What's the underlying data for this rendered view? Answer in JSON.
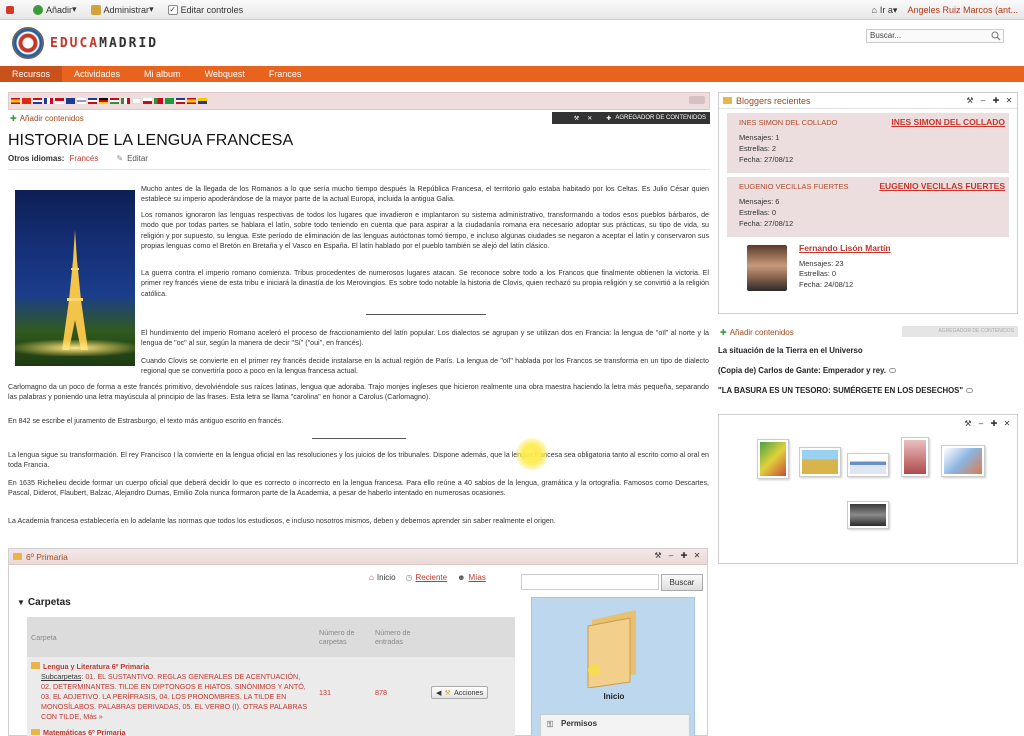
{
  "dockbar": {
    "add": "Añadir",
    "admin": "Administrar",
    "edit_controls": "Editar controles",
    "goto": "Ir a",
    "user": "Angeles Ruiz Marcos (ant..."
  },
  "header": {
    "logo_part1": "EDUCA",
    "logo_part2": "MADRID",
    "search_value": "Buscar..."
  },
  "nav": {
    "tabs": [
      {
        "label": "Recursos",
        "active": true
      },
      {
        "label": "Actividades",
        "active": false
      },
      {
        "label": "Mi album",
        "active": false
      },
      {
        "label": "Webquest",
        "active": false
      },
      {
        "label": "Frances",
        "active": false
      }
    ]
  },
  "main": {
    "add_content": "Añadir contenidos",
    "aggregator": "AGREGADOR DE CONTENIDOS",
    "title": "HISTORIA DE LA LENGUA FRANCESA",
    "other_lang_label": "Otros idiomas:",
    "other_lang_value": "Francés",
    "edit": "Editar",
    "paragraphs": [
      "Mucho antes de la llegada de los Romanos a lo que sería mucho tiempo después la República Francesa, el territorio galo estaba habitado por los Celtas. Es Julio César quien establece su imperio apoderándose de la mayor parte de la actual Europa, incluida la antigua Galia.",
      "Los romanos ignoraron las lenguas respectivas de todos los lugares que invadieron e implantaron su sistema administrativo, transformando a todos esos pueblos bárbaros, de modo que por todas partes se hablara el latín, sobre todo teniendo en cuenta que para aspirar a la ciudadanía romana era necesario adoptar sus prácticas, su tipo de vida, su religión y por supuesto, su lengua. Este período de eliminación de las lenguas autóctonas tomó tiempo, e incluso algunas ciudades se negaron a aceptar el latín y conservaron sus propias lenguas como el Bretón en Bretaña y el Vasco en España. El latín hablado por el pueblo también se alejó del latín clásico.",
      "La guerra contra el imperio romano comienza. Tribus procedentes de numerosos lugares atacan. Se reconoce sobre todo a los Francos que finalmente obtienen la victoria. El primer rey francés viene de esta tribu e iniciará la dinastía de los Merovingios. Es sobre todo notable la historia de Clovis, quien rechazó su propia religión y se convirtió a la religión católica.",
      "El hundimiento del imperio Romano aceleró el proceso de fraccionamiento del latín popular. Los dialectos se agrupan y se utilizan dos en Francia: la lengua de \"oïl\" al norte y la lengua de \"oc\" al sur, según la manera de decir \"Sí\" (\"oui\", en francés).",
      "Cuando Clovis se convierte en el primer rey francés decide instalarse en la actual región de París. La lengua de \"oïl\" hablada por los Francos se transforma en un tipo de dialecto regional que se convertiría poco a poco en la lengua francesa actual.",
      "Carlomagno da un poco de forma a este francés primitivo, devolviéndole sus raíces latinas, lengua que adoraba. Trajo monjes ingleses que hicieron realmente una obra maestra haciendo la letra más pequeña, separando las palabras y poniendo una letra mayúscula al principio de las frases. Esta letra se llama \"carolina\" en honor a Carolus (Carlomagno).",
      "En 842 se escribe el juramento de Estrasburgo, el texto más antiguo escrito en francés.",
      "La lengua sigue su transformación. El rey Francisco I la convierte en la lengua oficial en las resoluciones y los juicios de los tribunales. Dispone además, que la lengua francesa sea obligatoria tanto al escrito como al oral en toda Francia.",
      "En 1635 Richelieu decide formar un cuerpo oficial que deberá decidir lo que es correcto o incorrecto en la lengua francesa. Para ello reúne a 40 sabios de la lengua, gramática y la ortografía. Famosos como Descartes, Pascal, Diderot, Flaubert, Balzac, Alejandro Dumas, Emilio Zola nunca formaron parte de la Academia, a pesar de haberlo intentado en numerosas ocasiones.",
      "La Academia francesa establecería en lo adelante las normas que todos los estudiosos, e incluso nosotros mismos, deben y debemos aprender sin saber realmente el origen."
    ]
  },
  "folders": {
    "title": "6º Primaria",
    "toolbar_home": "Inicio",
    "toolbar_recent": "Reciente",
    "toolbar_mine": "Mías",
    "search_btn": "Buscar",
    "carpetas": "Carpetas",
    "col_folder": "Carpeta",
    "col_num_folders": "Número de carpetas",
    "col_num_entries": "Número de entradas",
    "row_name": "Lengua y Literatura 6º Primaria",
    "row_sub_label": "Subcarpetas",
    "row_sub_text": ": 01. EL SUSTANTIVO. REGLAS GENERALES DE ACENTUACIÓN, 02. DETERMINANTES. TILDE EN DIPTONGOS E HIATOS. SINÓNIMOS Y ANTÓ, 03. EL ADJETIVO. LA PERÍFRASIS, 04. LOS PRONOMBRES. LA TILDE EN MONOSÍLABOS. PALABRAS DERIVADAS, 05. EL VERBO (I). OTRAS PALABRAS CON TILDE, Más »",
    "row_folders": "131",
    "row_entries": "878",
    "actions": "Acciones",
    "next_row": "Matemáticas 6º Primaria",
    "panel_label": "Inicio",
    "permisos": "Permisos"
  },
  "bloggers": {
    "title": "Bloggers recientes",
    "items": [
      {
        "small": "INES SIMON DEL COLLADO",
        "big": "INES SIMON DEL COLLADO",
        "mensajes": "Mensajes: 1",
        "estrellas": "Estrellas: 2",
        "fecha": "Fecha: 27/08/12"
      },
      {
        "small": "EUGENIO VECILLAS FUERTES",
        "big": "EUGENIO VECILLAS FUERTES",
        "mensajes": "Mensajes: 6",
        "estrellas": "Estrellas: 0",
        "fecha": "Fecha: 27/08/12"
      }
    ],
    "third": {
      "big": "Fernando Lisón Martín",
      "mensajes": "Mensajes: 23",
      "estrellas": "Estrellas: 0",
      "fecha": "Fecha: 24/08/12"
    }
  },
  "side": {
    "add_content": "Añadir contenidos",
    "aggregator": "AGREGADOR DE CONTENIDOS",
    "news": [
      "La situación de la Tierra en el Universo",
      "(Copia de) Carlos de Gante: Emperador y rey.",
      "\"LA BASURA ES UN TESORO: SUMÉRGETE EN LOS DESECHOS\""
    ]
  }
}
